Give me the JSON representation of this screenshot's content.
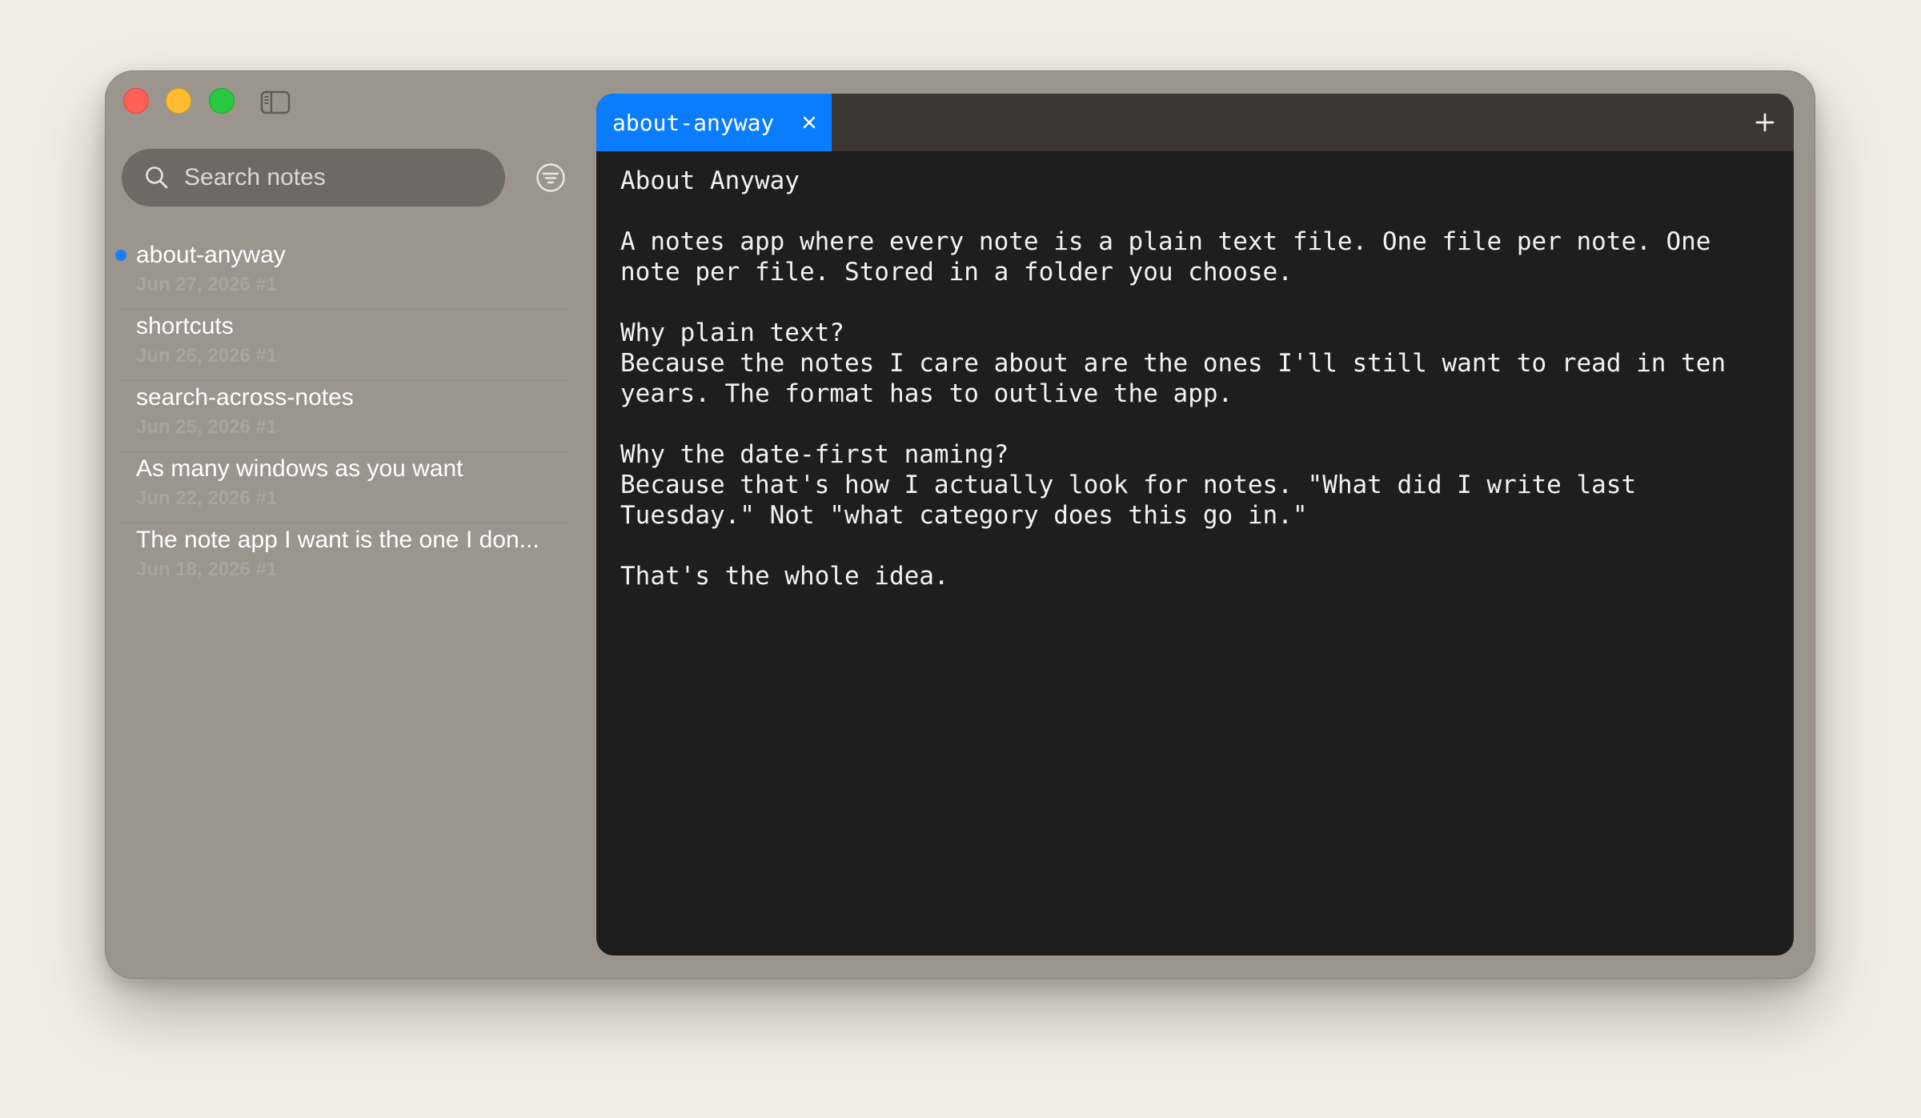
{
  "sidebar": {
    "search": {
      "placeholder": "Search notes",
      "value": ""
    },
    "notes": [
      {
        "title": "about-anyway",
        "date": "Jun 27, 2026 #1",
        "active": true
      },
      {
        "title": "shortcuts",
        "date": "Jun 26, 2026 #1",
        "active": false
      },
      {
        "title": "search-across-notes",
        "date": "Jun 25, 2026 #1",
        "active": false
      },
      {
        "title": "As many windows as you want",
        "date": "Jun 22, 2026 #1",
        "active": false
      },
      {
        "title": "The note app I want is the one I don...",
        "date": "Jun 18, 2026 #1",
        "active": false
      }
    ]
  },
  "editor": {
    "tabs": [
      {
        "label": "about-anyway"
      }
    ],
    "lines": [
      "About Anyway",
      "",
      "A notes app where every note is a plain text file. One file per note. One",
      "note per file. Stored in a folder you choose.",
      "",
      "Why plain text?",
      "Because the notes I care about are the ones I'll still want to read in ten",
      "years. The format has to outlive the app.",
      "",
      "Why the date-first naming?",
      "Because that's how I actually look for notes. \"What did I write last",
      "Tuesday.\" Not \"what category does this go in.\"",
      "",
      "That's the whole idea."
    ]
  },
  "colors": {
    "accent": "#0a7cff",
    "active_dot": "#1a7cff",
    "sidebar_bg": "#9b958d",
    "editor_bg": "#1e1e1e",
    "tabbar_bg": "#3a3735"
  },
  "icons": {
    "close_window": "close-window-icon",
    "minimize_window": "minimize-window-icon",
    "zoom_window": "zoom-window-icon",
    "sidebar_toggle": "sidebar-toggle-icon",
    "search": "search-icon",
    "filter": "filter-icon",
    "tab_close": "close-icon",
    "new_tab": "plus-icon"
  }
}
